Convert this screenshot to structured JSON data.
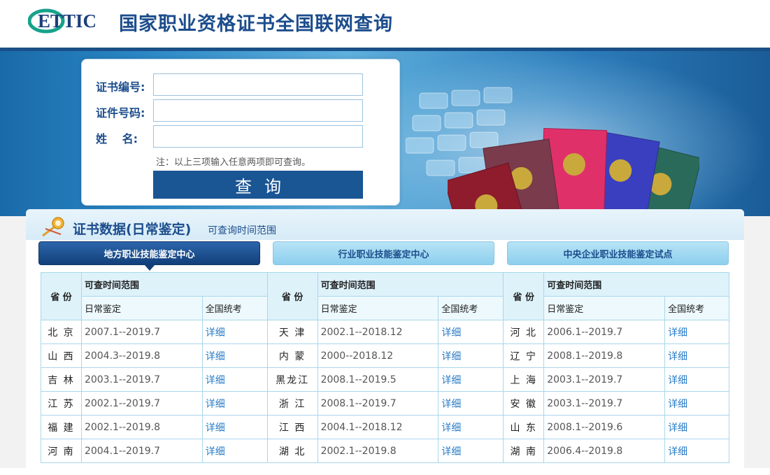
{
  "header": {
    "logo_text": "ETTIC",
    "title": "国家职业资格证书全国联网查询"
  },
  "search": {
    "cert_no_label": "证书编号:",
    "id_no_label": "证件号码:",
    "name_label": "姓　 名:",
    "cert_no_value": "",
    "id_no_value": "",
    "name_value": "",
    "note": "注：以上三项输入任意两项即可查询。",
    "button_label": "查询"
  },
  "section": {
    "title": "证书数据(日常鉴定)",
    "subtitle": "可查询时间范围"
  },
  "tabs": [
    {
      "label": "地方职业技能鉴定中心"
    },
    {
      "label": "行业职业技能鉴定中心"
    },
    {
      "label": "中央企业职业技能鉴定试点"
    }
  ],
  "table": {
    "province_header": "省 份",
    "range_header": "可查时间范围",
    "daily_header": "日常鉴定",
    "national_header": "全国统考",
    "link_text": "详细",
    "rows": [
      [
        {
          "province": "北 京",
          "range": "2007.1--2019.7"
        },
        {
          "province": "天 津",
          "range": "2002.1--2018.12"
        },
        {
          "province": "河 北",
          "range": "2006.1--2019.7"
        }
      ],
      [
        {
          "province": "山 西",
          "range": "2004.3--2019.8"
        },
        {
          "province": "内 蒙",
          "range": "2000--2018.12"
        },
        {
          "province": "辽 宁",
          "range": "2008.1--2019.8"
        }
      ],
      [
        {
          "province": "吉 林",
          "range": "2003.1--2019.7"
        },
        {
          "province": "黑龙江",
          "range": "2008.1--2019.5"
        },
        {
          "province": "上 海",
          "range": "2003.1--2019.7"
        }
      ],
      [
        {
          "province": "江 苏",
          "range": "2002.1--2019.7"
        },
        {
          "province": "浙 江",
          "range": "2008.1--2019.7"
        },
        {
          "province": "安 徽",
          "range": "2003.1--2019.7"
        }
      ],
      [
        {
          "province": "福 建",
          "range": "2002.1--2019.8"
        },
        {
          "province": "江 西",
          "range": "2004.1--2018.12"
        },
        {
          "province": "山 东",
          "range": "2008.1--2019.6"
        }
      ],
      [
        {
          "province": "河 南",
          "range": "2004.1--2019.7"
        },
        {
          "province": "湖 北",
          "range": "2002.1--2019.8"
        },
        {
          "province": "湖 南",
          "range": "2006.4--2019.8"
        }
      ]
    ]
  },
  "colors": {
    "brand": "#1c4d8c",
    "button": "#1a5594",
    "link": "#2a7cc7",
    "border": "#a9d7eb"
  }
}
